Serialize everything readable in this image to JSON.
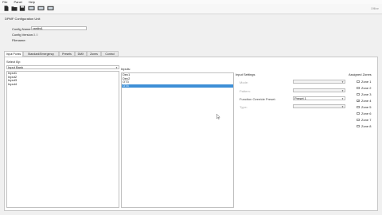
{
  "menu": [
    "File",
    "Panel",
    "Help"
  ],
  "toolbar": {
    "status": "Offline"
  },
  "config": {
    "title": "DPMF Configuration Unit",
    "name_label": "Config Name:",
    "name_value": "cardiro1",
    "version_label": "Config Version:",
    "version_value": "3.0",
    "filename_label": "Filename:"
  },
  "tabs": [
    "Input Points",
    "Standard/Emergency",
    "Presets",
    "DMX",
    "Zones",
    "Control"
  ],
  "select": {
    "label": "Select By:",
    "value": "Input Bank"
  },
  "banks": [
    "Input1",
    "Input2",
    "Input3",
    "Input4"
  ],
  "inputs_label": "Inputs:",
  "inputs": [
    "Dec1",
    "Dec2",
    "OT3",
    "OT4"
  ],
  "settings": {
    "title": "Input Settings",
    "mode_label": "Mode:",
    "pattern_label": "Pattern:",
    "preset_label": "Function Override Preset:",
    "preset_value": "Preset 1",
    "type_label": "Type:"
  },
  "zones": {
    "title": "Assigned Zones",
    "items": [
      "Zone 1",
      "Zone 2",
      "Zone 3",
      "Zone 4",
      "Zone 5",
      "Zone 6",
      "Zone 7",
      "Zone 8"
    ],
    "checked": [
      false,
      false,
      false,
      true,
      false,
      false,
      false,
      false
    ]
  }
}
